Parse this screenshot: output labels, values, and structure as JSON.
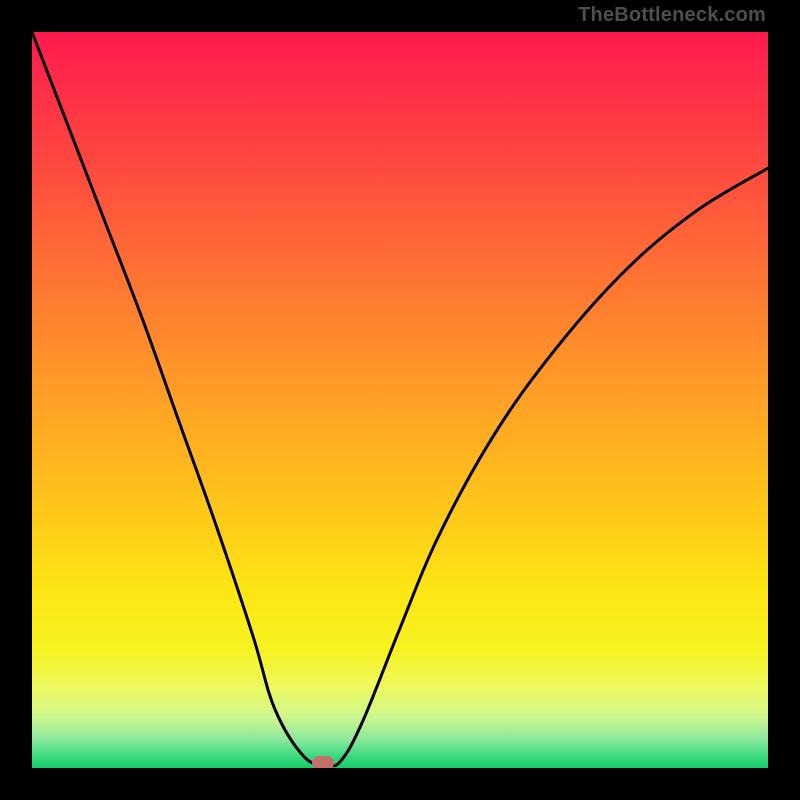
{
  "watermark": "TheBottleneck.com",
  "chart_data": {
    "type": "line",
    "title": "",
    "xlabel": "",
    "ylabel": "",
    "xlim": [
      0,
      1
    ],
    "ylim": [
      0,
      1
    ],
    "grid": false,
    "legend": false,
    "background_gradient": {
      "stops": [
        {
          "pos": 0.0,
          "color": "#ff1a4d"
        },
        {
          "pos": 0.18,
          "color": "#ff4840"
        },
        {
          "pos": 0.42,
          "color": "#ff8b2c"
        },
        {
          "pos": 0.66,
          "color": "#ffca19"
        },
        {
          "pos": 0.84,
          "color": "#f7f321"
        },
        {
          "pos": 0.93,
          "color": "#cff78e"
        },
        {
          "pos": 1.0,
          "color": "#14cf68"
        }
      ]
    },
    "series": [
      {
        "name": "bottleneck-curve",
        "x": [
          0.0,
          0.05,
          0.1,
          0.15,
          0.2,
          0.25,
          0.3,
          0.33,
          0.37,
          0.4,
          0.42,
          0.45,
          0.5,
          0.55,
          0.62,
          0.7,
          0.8,
          0.9,
          1.0
        ],
        "y": [
          1.0,
          0.87,
          0.74,
          0.61,
          0.47,
          0.33,
          0.18,
          0.08,
          0.015,
          0.005,
          0.01,
          0.065,
          0.19,
          0.31,
          0.44,
          0.555,
          0.67,
          0.755,
          0.815
        ]
      }
    ],
    "marker": {
      "x": 0.395,
      "y": 0.007,
      "color": "#c36f6a"
    }
  }
}
